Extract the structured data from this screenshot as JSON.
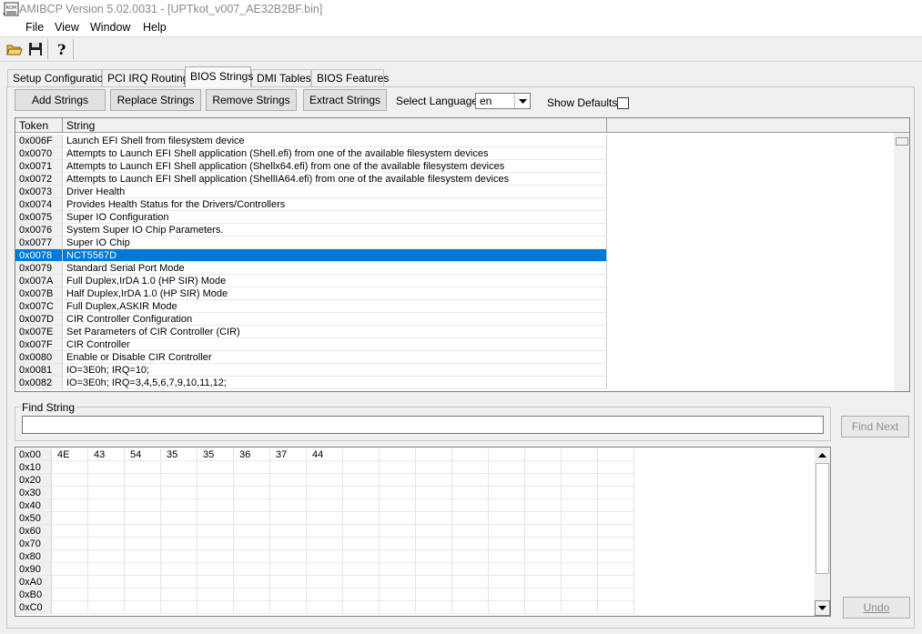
{
  "window": {
    "title": "AMIBCP Version 5.02.0031 - [UPTkot_v007_AE32B2BF.bin]"
  },
  "menu": {
    "items": [
      "File",
      "View",
      "Window",
      "Help"
    ]
  },
  "toolbar": {
    "icons": [
      "open-folder-icon",
      "save-disk-icon",
      "help-question-icon"
    ]
  },
  "tabs": [
    "Setup Configuration",
    "PCI IRQ Routing",
    "BIOS Strings",
    "DMI Tables",
    "BIOS Features"
  ],
  "active_tab": "BIOS Strings",
  "actions": {
    "add": "Add Strings",
    "replace": "Replace Strings",
    "remove": "Remove Strings",
    "extract": "Extract Strings",
    "select_language_label": "Select Language",
    "language_value": "en",
    "show_defaults_label": "Show Defaults",
    "show_defaults_checked": false
  },
  "string_table": {
    "headers": {
      "token": "Token",
      "string": "String"
    },
    "rows": [
      {
        "token": "0x006F",
        "string": "Launch EFI Shell from filesystem device"
      },
      {
        "token": "0x0070",
        "string": "Attempts to Launch EFI Shell application (Shell.efi) from one of the available filesystem devices"
      },
      {
        "token": "0x0071",
        "string": "Attempts to Launch EFI Shell application (Shellx64.efi) from one of the available filesystem devices"
      },
      {
        "token": "0x0072",
        "string": "Attempts to Launch EFI Shell application (ShellIA64.efi) from one of the available filesystem devices"
      },
      {
        "token": "0x0073",
        "string": "Driver Health"
      },
      {
        "token": "0x0074",
        "string": "Provides Health Status for the Drivers/Controllers"
      },
      {
        "token": "0x0075",
        "string": "Super IO Configuration"
      },
      {
        "token": "0x0076",
        "string": "System Super IO Chip Parameters."
      },
      {
        "token": "0x0077",
        "string": "Super IO Chip"
      },
      {
        "token": "0x0078",
        "string": "NCT5567D",
        "selected": true
      },
      {
        "token": "0x0079",
        "string": "Standard Serial Port Mode"
      },
      {
        "token": "0x007A",
        "string": "Full Duplex,IrDA 1.0 (HP SIR) Mode"
      },
      {
        "token": "0x007B",
        "string": "Half Duplex,IrDA 1.0 (HP SIR) Mode"
      },
      {
        "token": "0x007C",
        "string": "Full Duplex,ASKIR Mode"
      },
      {
        "token": "0x007D",
        "string": "CIR Controller Configuration"
      },
      {
        "token": "0x007E",
        "string": "Set Parameters of CIR Controller (CIR)"
      },
      {
        "token": "0x007F",
        "string": "CIR Controller"
      },
      {
        "token": "0x0080",
        "string": "Enable or Disable CIR Controller"
      },
      {
        "token": "0x0081",
        "string": "IO=3E0h; IRQ=10;"
      },
      {
        "token": "0x0082",
        "string": "IO=3E0h; IRQ=3,4,5,6,7,9,10,11,12;"
      }
    ]
  },
  "find": {
    "label": "Find String",
    "value": "",
    "button": "Find Next"
  },
  "hex_view": {
    "addresses": [
      "0x00",
      "0x10",
      "0x20",
      "0x30",
      "0x40",
      "0x50",
      "0x60",
      "0x70",
      "0x80",
      "0x90",
      "0xA0",
      "0xB0",
      "0xC0"
    ],
    "first_row_bytes": [
      "4E",
      "43",
      "54",
      "35",
      "35",
      "36",
      "37",
      "44"
    ]
  },
  "undo_button": "Undo",
  "colors": {
    "selection": "#0078d7",
    "logo": "#c8202a"
  }
}
